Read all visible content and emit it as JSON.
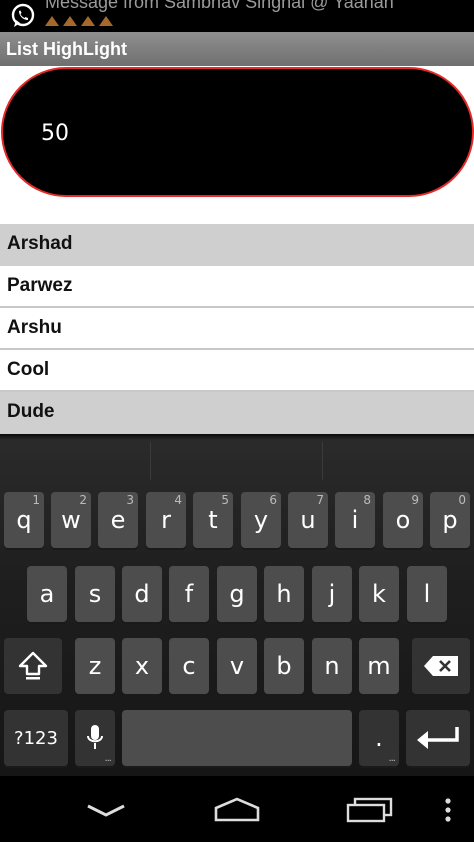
{
  "status_bar": {
    "app_icon": "whatsapp-icon",
    "notification_text": "Message from Sambhav Singhal @ Yaanah"
  },
  "action_bar": {
    "title": "List HighLight"
  },
  "pill": {
    "value": "50",
    "border_color": "#e52a2a"
  },
  "list": {
    "items": [
      "Arshad",
      "Parwez",
      "Arshu",
      "Cool",
      "Dude"
    ],
    "highlighted": [
      "Arshad",
      "Dude"
    ]
  },
  "keyboard": {
    "row1": [
      {
        "k": "q",
        "h": "1"
      },
      {
        "k": "w",
        "h": "2"
      },
      {
        "k": "e",
        "h": "3"
      },
      {
        "k": "r",
        "h": "4"
      },
      {
        "k": "t",
        "h": "5"
      },
      {
        "k": "y",
        "h": "6"
      },
      {
        "k": "u",
        "h": "7"
      },
      {
        "k": "i",
        "h": "8"
      },
      {
        "k": "o",
        "h": "9"
      },
      {
        "k": "p",
        "h": "0"
      }
    ],
    "row2": [
      "a",
      "s",
      "d",
      "f",
      "g",
      "h",
      "j",
      "k",
      "l"
    ],
    "row3": [
      "z",
      "x",
      "c",
      "v",
      "b",
      "n",
      "m"
    ],
    "symbols_label": "?123",
    "period_label": ".",
    "icons": [
      "shift-icon",
      "backspace-icon",
      "microphone-icon",
      "enter-icon"
    ]
  },
  "nav": {
    "icons": [
      "back-icon",
      "home-icon",
      "recent-apps-icon",
      "overflow-menu-icon"
    ]
  }
}
